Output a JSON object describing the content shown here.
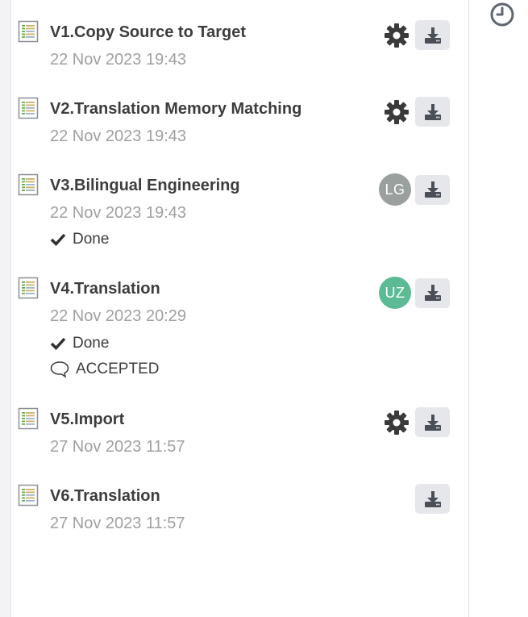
{
  "colors": {
    "title": "#3d3d3d",
    "date": "#a0a0a0",
    "download_bg": "#e6e7ea",
    "avatar_lg": "#9aa09d",
    "avatar_uz": "#5cbb94",
    "history_icon": "#5f6670"
  },
  "history_icon_name": "history-clock-icon",
  "versions": [
    {
      "title": "V1.Copy Source to Target",
      "date": "22 Nov 2023 19:43",
      "action_icon": "gear-icon"
    },
    {
      "title": "V2.Translation Memory Matching",
      "date": "22 Nov 2023 19:43",
      "action_icon": "gear-icon"
    },
    {
      "title": "V3.Bilingual Engineering",
      "date": "22 Nov 2023 19:43",
      "avatar": "LG",
      "status": "Done"
    },
    {
      "title": "V4.Translation",
      "date": "22 Nov 2023 20:29",
      "avatar": "UZ",
      "status": "Done",
      "review": "ACCEPTED"
    },
    {
      "title": "V5.Import",
      "date": "27 Nov 2023 11:57",
      "action_icon": "gear-icon"
    },
    {
      "title": "V6.Translation",
      "date": "27 Nov 2023 11:57"
    }
  ]
}
